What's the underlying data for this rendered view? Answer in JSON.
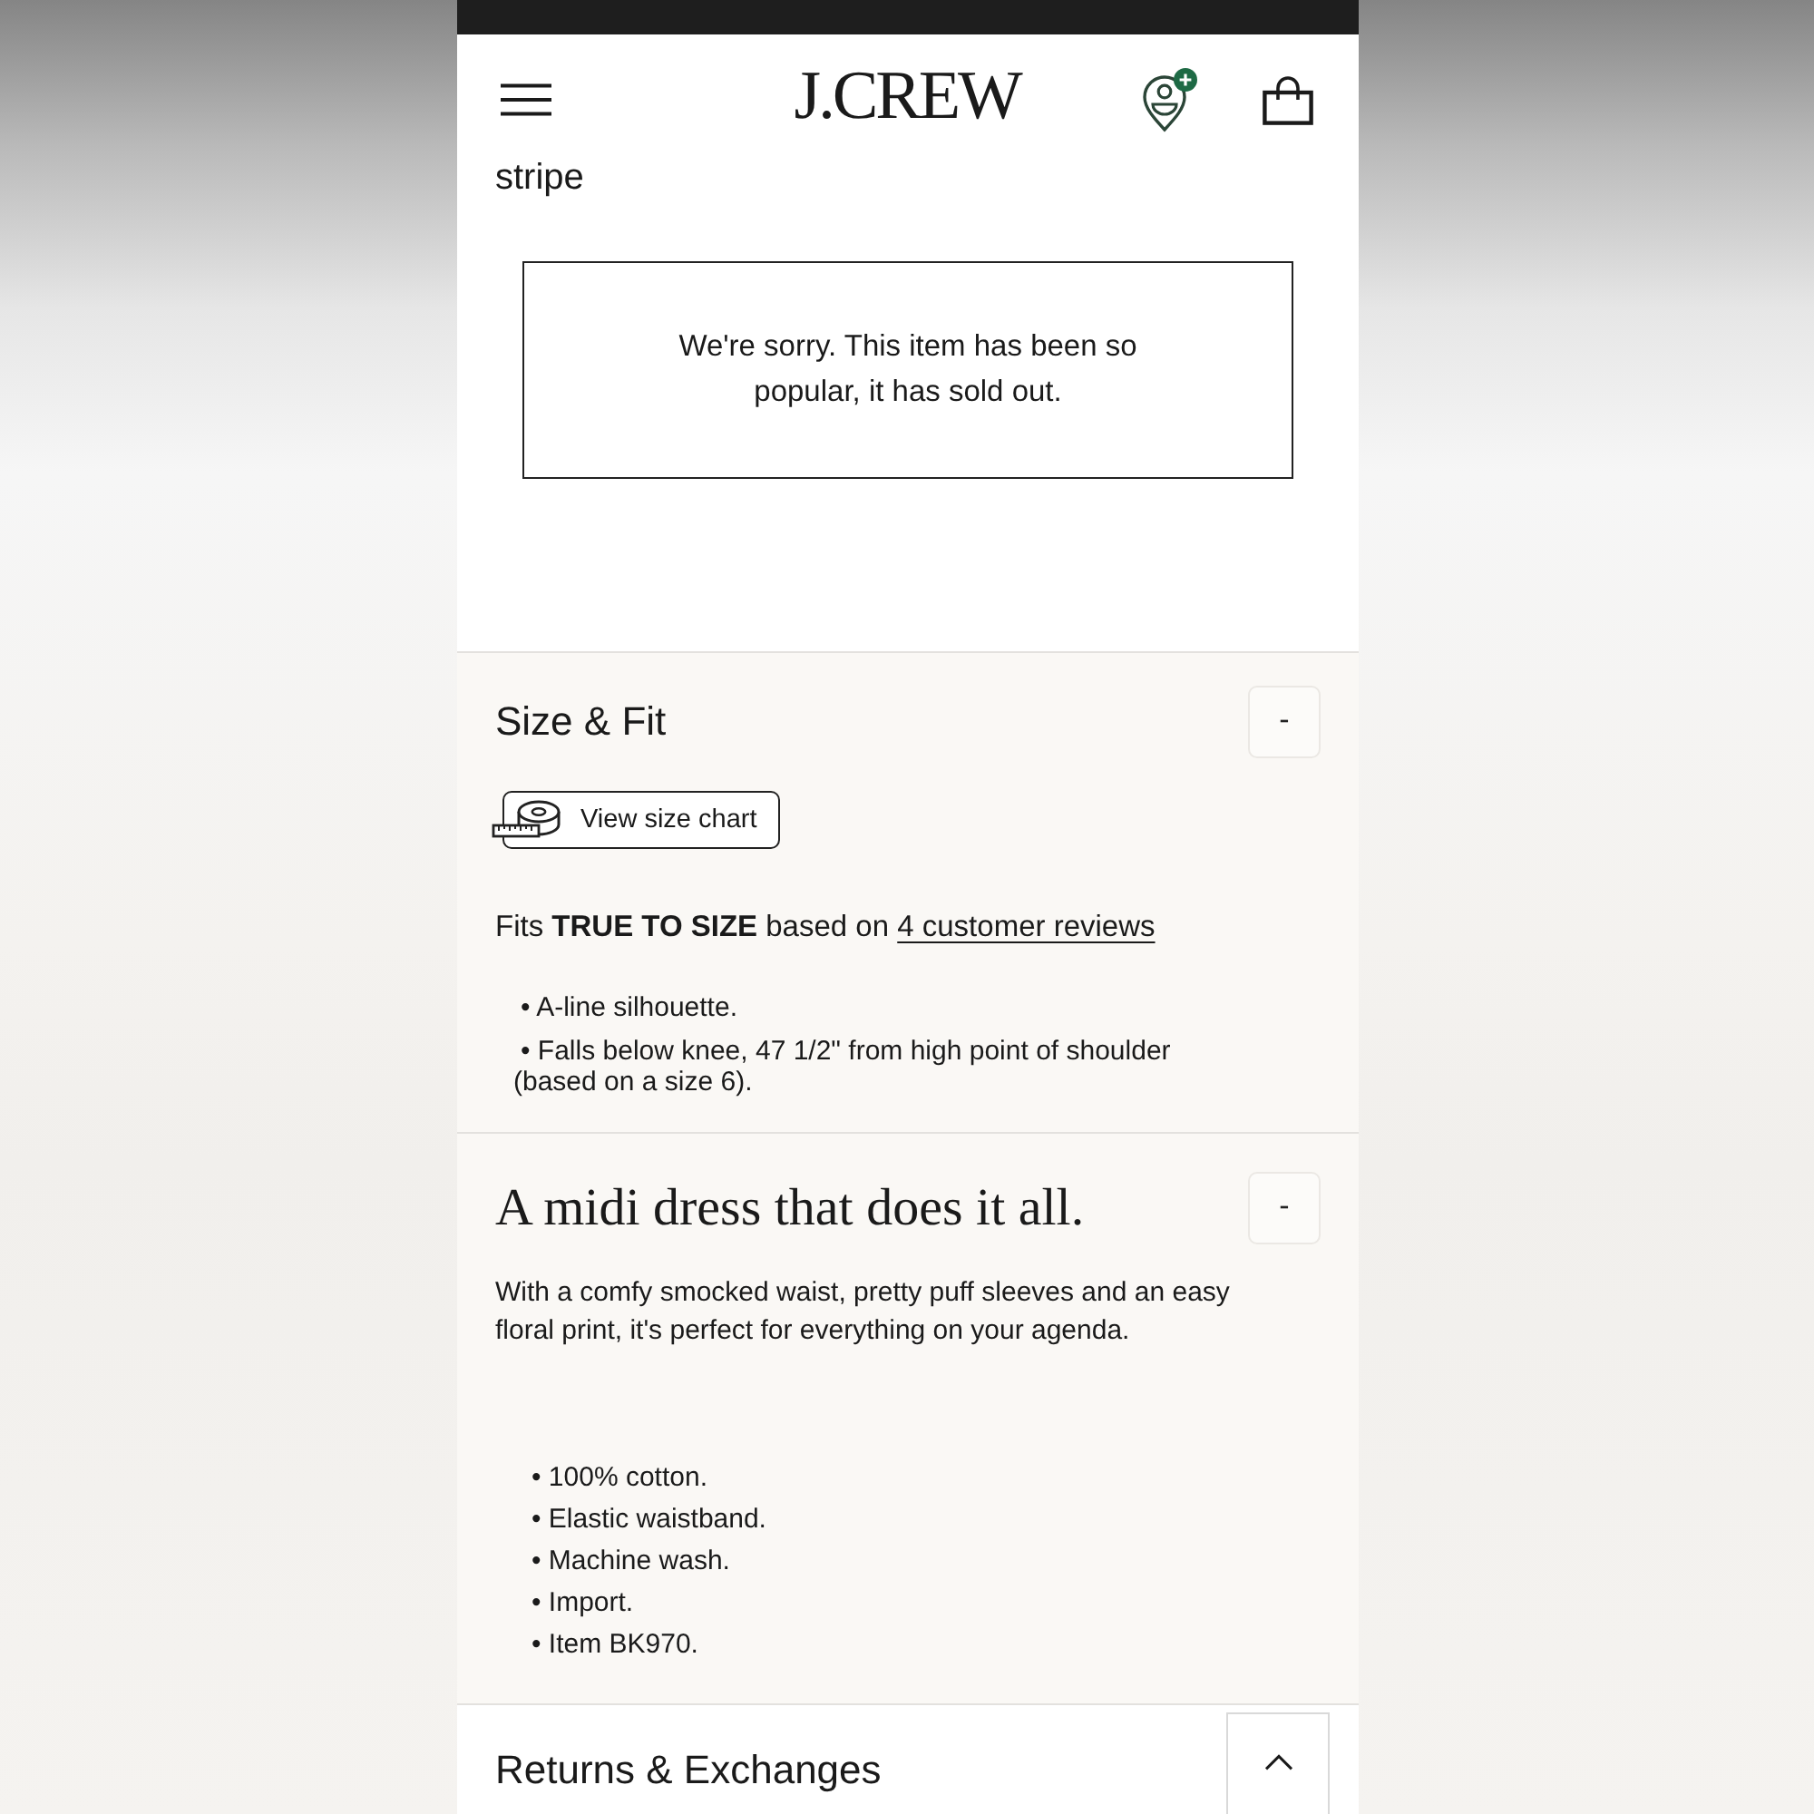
{
  "header": {
    "logo": "J.CREW"
  },
  "product_title": "stripe",
  "sold_out_notice": "We're sorry. This item has been so popular, it has sold out.",
  "sections": [
    {
      "kind": "size_fit",
      "title": "Size & Fit",
      "expanded": true,
      "toggle": "-",
      "size_chart_button": "View size chart",
      "fit_note": "Fits **TRUE TO SIZE** based on",
      "reviews_link": "4 customer reviews",
      "bullets": [
        "• A-line silhouette.",
        "• Falls below knee, 47 1/2\" from high point of shoulder (based on a size 6)."
      ]
    },
    {
      "kind": "description",
      "title": "A midi dress that does it all.",
      "expanded": true,
      "toggle": "-",
      "paragraph": "With a comfy smocked waist, pretty puff sleeves and an easy floral print, it's perfect for everything on your agenda.",
      "bullets": [
        "• 100% cotton.",
        "• Elastic waistband.",
        "• Machine wash.",
        "• Import.",
        "• Item BK970."
      ]
    },
    {
      "kind": "plain",
      "title": "Returns & Exchanges",
      "expanded": false
    }
  ]
}
